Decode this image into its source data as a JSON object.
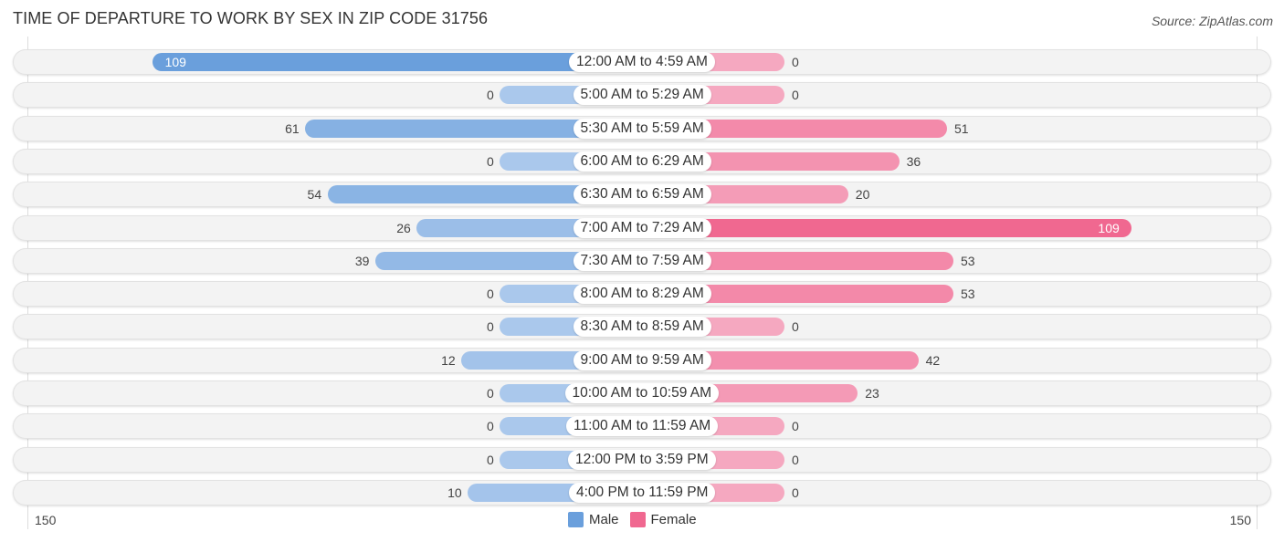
{
  "title": "TIME OF DEPARTURE TO WORK BY SEX IN ZIP CODE 31756",
  "source": "Source: ZipAtlas.com",
  "colors": {
    "male": "#6a9fdc",
    "male_light": "#aac8ec",
    "female": "#f06890",
    "female_light": "#f5a8c0"
  },
  "chart_data": {
    "type": "bar",
    "orientation": "horizontal-diverging",
    "title": "TIME OF DEPARTURE TO WORK BY SEX IN ZIP CODE 31756",
    "categories": [
      "12:00 AM to 4:59 AM",
      "5:00 AM to 5:29 AM",
      "5:30 AM to 5:59 AM",
      "6:00 AM to 6:29 AM",
      "6:30 AM to 6:59 AM",
      "7:00 AM to 7:29 AM",
      "7:30 AM to 7:59 AM",
      "8:00 AM to 8:29 AM",
      "8:30 AM to 8:59 AM",
      "9:00 AM to 9:59 AM",
      "10:00 AM to 10:59 AM",
      "11:00 AM to 11:59 AM",
      "12:00 PM to 3:59 PM",
      "4:00 PM to 11:59 PM"
    ],
    "series": [
      {
        "name": "Male",
        "values": [
          109,
          0,
          61,
          0,
          54,
          26,
          39,
          0,
          0,
          12,
          0,
          0,
          0,
          10
        ]
      },
      {
        "name": "Female",
        "values": [
          0,
          0,
          51,
          36,
          20,
          109,
          53,
          53,
          0,
          42,
          23,
          0,
          0,
          0
        ]
      }
    ],
    "axis": {
      "left_label": "150",
      "right_label": "150",
      "range": [
        -150,
        150
      ]
    },
    "legend": {
      "position": "bottom-center",
      "items": [
        "Male",
        "Female"
      ]
    }
  }
}
